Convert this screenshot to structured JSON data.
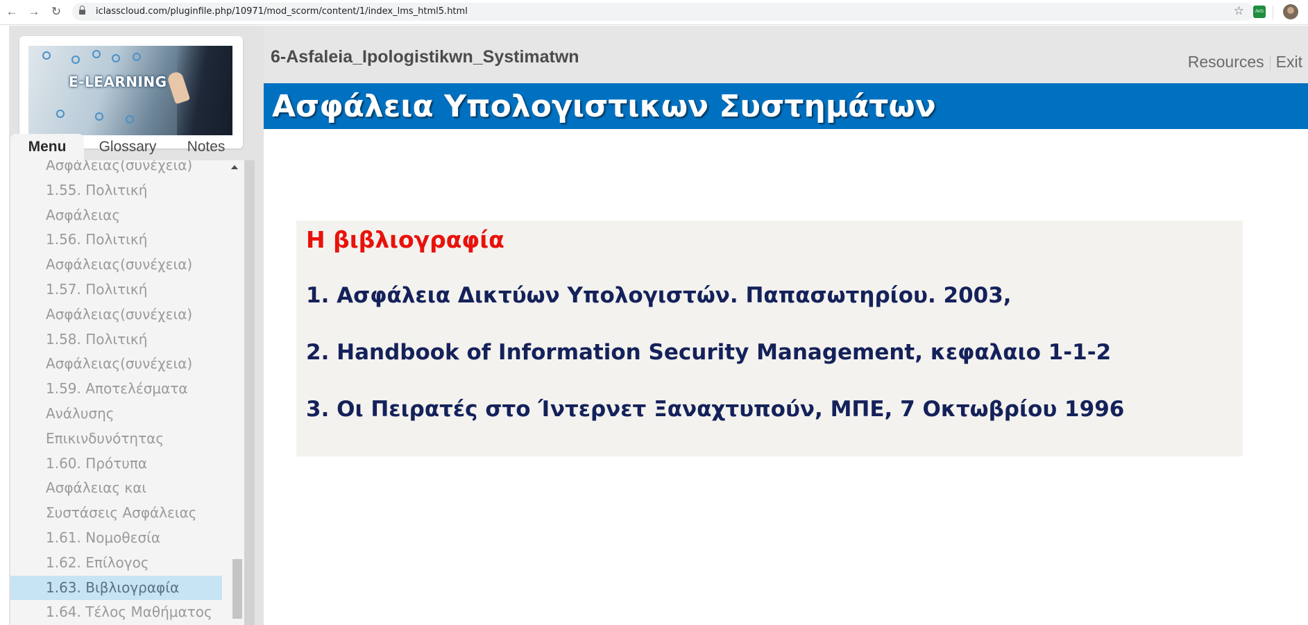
{
  "browser": {
    "url": "iclasscloud.com/pluginfile.php/10971/mod_scorm/content/1/index_lms_html5.html",
    "back_icon": "arrow-left-icon",
    "forward_icon": "arrow-right-icon",
    "reload_icon": "reload-icon",
    "bookmark_icon": "star-icon"
  },
  "logo": {
    "text": "E-LEARNING"
  },
  "tabs": [
    {
      "label": "Menu",
      "active": true
    },
    {
      "label": "Glossary",
      "active": false
    },
    {
      "label": "Notes",
      "active": false
    }
  ],
  "menu": {
    "items": [
      {
        "label": "Ασφάλειας(συνέχεια)"
      },
      {
        "label": "1.55. Πολιτική Ασφάλειας"
      },
      {
        "label": "1.56. Πολιτική"
      },
      {
        "label": "Ασφάλειας(συνέχεια)"
      },
      {
        "label": "1.57. Πολιτική"
      },
      {
        "label": "Ασφάλειας(συνέχεια)"
      },
      {
        "label": "1.58. Πολιτική"
      },
      {
        "label": "Ασφάλειας(συνέχεια)"
      },
      {
        "label": "1.59. Αποτελέσματα"
      },
      {
        "label": "Ανάλυσης"
      },
      {
        "label": "Επικινδυνότητας"
      },
      {
        "label": "1.60. Πρότυπα"
      },
      {
        "label": "Ασφάλειας και"
      },
      {
        "label": "Συστάσεις Ασφάλειας"
      },
      {
        "label": "1.61. Νομοθεσία"
      },
      {
        "label": "1.62. Επίλογος"
      },
      {
        "label": "1.63. Βιβλιογραφία"
      },
      {
        "label": "1.64. Τέλος Μαθήματος"
      }
    ],
    "active_label": "1.63. Βιβλιογραφία"
  },
  "header": {
    "course_title": "6-Asfaleia_Ipologistikwn_Systimatwn",
    "resources_label": "Resources",
    "exit_label": "Exit"
  },
  "slide": {
    "title": "Ασφάλεια Υπολογιστικων Συστημάτων",
    "heading": "Η βιβλιογραφία",
    "references": [
      "1. Ασφάλεια Δικτύων Υπολογιστών. Παπασωτηρίου. 2003,",
      "2. Handbook of Information Security Management, κεφαλαιο 1-1-2",
      "3. Οι Πειρατές στο Ίντερνετ Ξαναχτυπούν, ΜΠΕ, 7 Οκτωβρίου 1996"
    ]
  },
  "colors": {
    "banner_blue": "#0071c1",
    "heading_red": "#e8120c",
    "reference_navy": "#14215a",
    "menu_active_bg": "#c6e4f3"
  }
}
